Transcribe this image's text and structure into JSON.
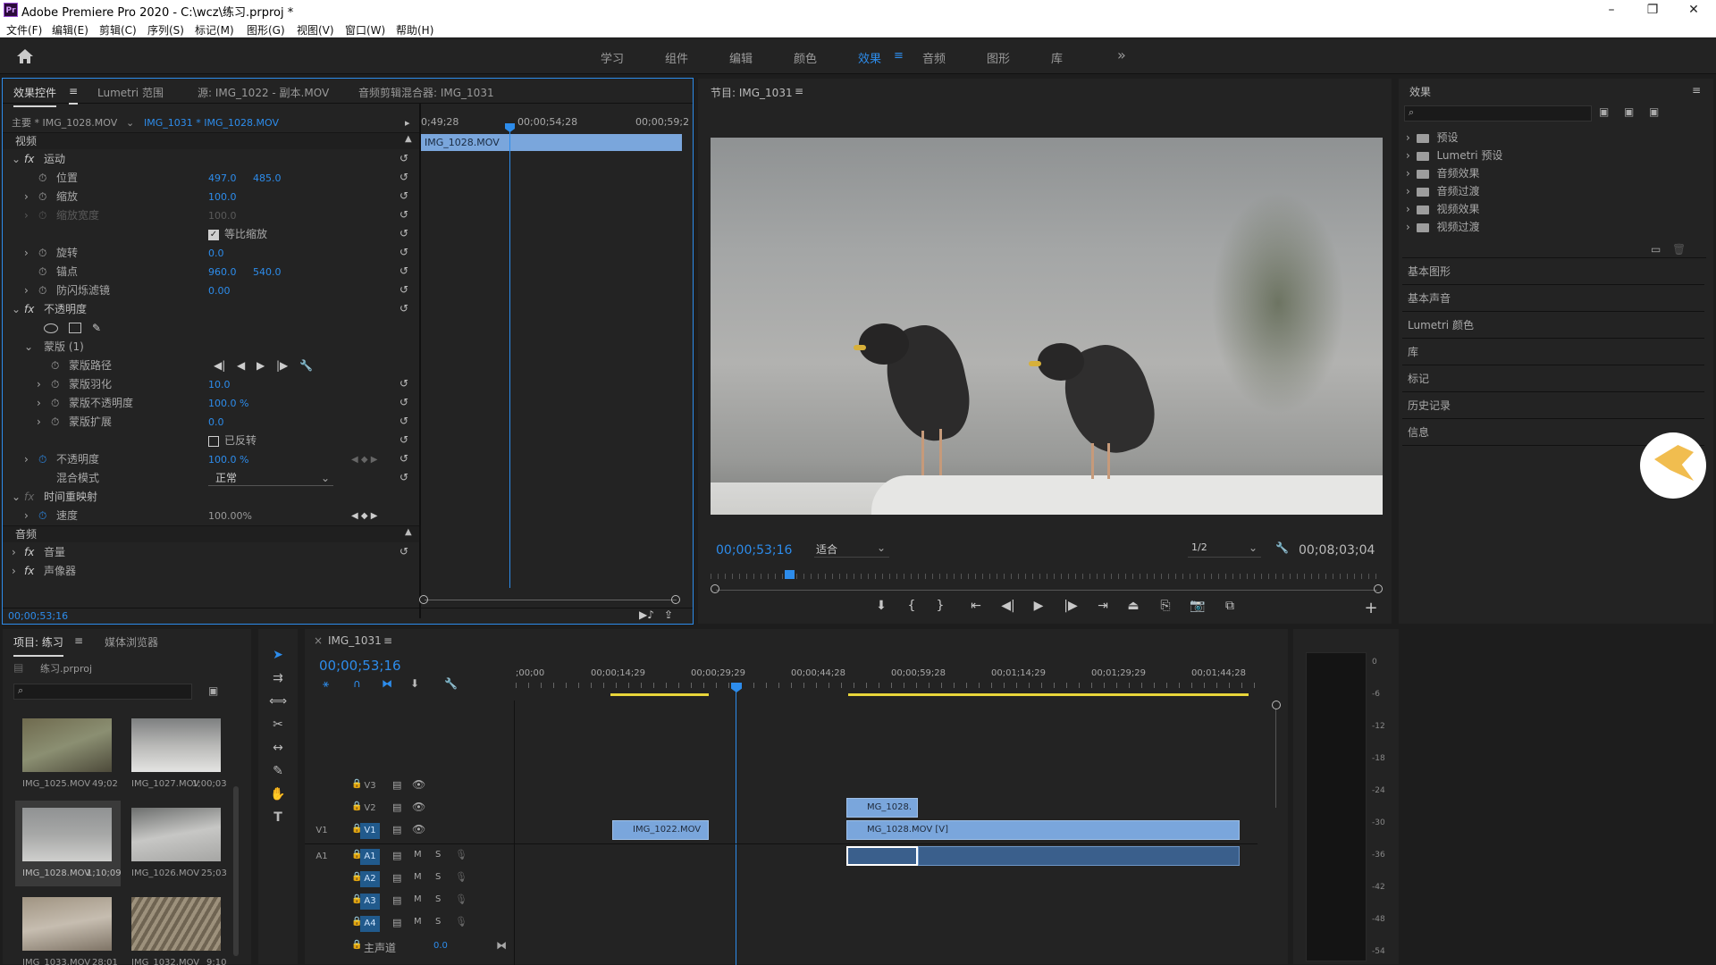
{
  "app": {
    "title": "Adobe Premiere Pro 2020 - C:\\wcz\\练习.prproj *",
    "logo": "Pr"
  },
  "window": {
    "minimize": "–",
    "maximize": "❐",
    "close": "✕"
  },
  "menu": [
    "文件(F)",
    "编辑(E)",
    "剪辑(C)",
    "序列(S)",
    "标记(M)",
    "图形(G)",
    "视图(V)",
    "窗口(W)",
    "帮助(H)"
  ],
  "workspaces": {
    "items": [
      "学习",
      "组件",
      "编辑",
      "颜色",
      "效果",
      "音频",
      "图形",
      "库"
    ],
    "active": "效果",
    "menu_icon": "≡",
    "overflow": "»"
  },
  "effect_controls": {
    "tabs": [
      "效果控件",
      "Lumetri 范围",
      "源: IMG_1022 - 副本.MOV",
      "音频剪辑混合器: IMG_1031"
    ],
    "tab_menu": "≡",
    "master": "主要 * IMG_1028.MOV",
    "sequence_clip": "IMG_1031 * IMG_1028.MOV",
    "ruler": [
      "0;49;28",
      "00;00;54;28",
      "00;00;59;2"
    ],
    "clip_name": "IMG_1028.MOV",
    "video_header": "视频",
    "audio_header": "音频",
    "motion": "运动",
    "position": {
      "label": "位置",
      "x": "497.0",
      "y": "485.0"
    },
    "scale": {
      "label": "缩放",
      "value": "100.0"
    },
    "scale_width": {
      "label": "缩放宽度",
      "value": "100.0"
    },
    "uniform_scale": "等比缩放",
    "rotation": {
      "label": "旋转",
      "value": "0.0"
    },
    "anchor": {
      "label": "锚点",
      "x": "960.0",
      "y": "540.0"
    },
    "antiflicker": {
      "label": "防闪烁滤镜",
      "value": "0.00"
    },
    "opacity_fx": "不透明度",
    "mask": "蒙版 (1)",
    "mask_path": "蒙版路径",
    "mask_feather": {
      "label": "蒙版羽化",
      "value": "10.0"
    },
    "mask_opacity": {
      "label": "蒙版不透明度",
      "value": "100.0 %"
    },
    "mask_expansion": {
      "label": "蒙版扩展",
      "value": "0.0"
    },
    "inverted": "已反转",
    "opacity": {
      "label": "不透明度",
      "value": "100.0 %"
    },
    "blend_mode": {
      "label": "混合模式",
      "value": "正常"
    },
    "time_remap": "时间重映射",
    "speed": {
      "label": "速度",
      "value": "100.00%"
    },
    "volume": "音量",
    "panner": "声像器",
    "timecode": "00;00;53;16"
  },
  "program": {
    "title": "节目: IMG_1031",
    "timecode": "00;00;53;16",
    "fit": "适合",
    "resolution": "1/2",
    "duration": "00;08;03;04",
    "playhead_fraction": 0.11
  },
  "effects_panel": {
    "title": "效果",
    "search_placeholder": "",
    "tree": [
      "预设",
      "Lumetri 预设",
      "音频效果",
      "音频过渡",
      "视频效果",
      "视频过渡"
    ],
    "collapsed": [
      "基本图形",
      "基本声音",
      "Lumetri 颜色",
      "库",
      "标记",
      "历史记录",
      "信息"
    ]
  },
  "project": {
    "tabs": [
      "项目: 练习",
      "媒体浏览器"
    ],
    "file": "练习.prproj",
    "items": [
      {
        "name": "IMG_1025.MOV",
        "dur": "49;02"
      },
      {
        "name": "IMG_1027.MOV",
        "dur": "1;00;03"
      },
      {
        "name": "IMG_1028.MOV",
        "dur": "1;10;09"
      },
      {
        "name": "IMG_1026.MOV",
        "dur": "25;03"
      },
      {
        "name": "IMG_1033.MOV",
        "dur": "28;01"
      },
      {
        "name": "IMG_1032.MOV",
        "dur": "9;10"
      }
    ]
  },
  "timeline": {
    "title": "IMG_1031",
    "timecode": "00;00;53;16",
    "ruler": [
      ";00;00",
      "00;00;14;29",
      "00;00;29;29",
      "00;00;44;28",
      "00;00;59;28",
      "00;01;14;29",
      "00;01;29;29",
      "00;01;44;28"
    ],
    "tracks_video": [
      "V3",
      "V2",
      "V1"
    ],
    "tracks_audio": [
      "A1",
      "A2",
      "A3",
      "A4"
    ],
    "source_v": "V1",
    "source_a": "A1",
    "master": {
      "label": "主声道",
      "value": "0.0"
    },
    "mute": "M",
    "solo": "S",
    "clips": {
      "v2": "MG_1028.",
      "v1a": "IMG_1022.MOV",
      "v1b": "MG_1028.MOV [V]"
    }
  },
  "meter": {
    "scale": [
      "0",
      "-6",
      "-12",
      "-18",
      "-24",
      "-30",
      "-36",
      "-42",
      "-48",
      "-54"
    ]
  },
  "colors": {
    "accent": "#2d8ceb",
    "clip": "#7aa6dc",
    "work_area": "#e8d53a"
  }
}
